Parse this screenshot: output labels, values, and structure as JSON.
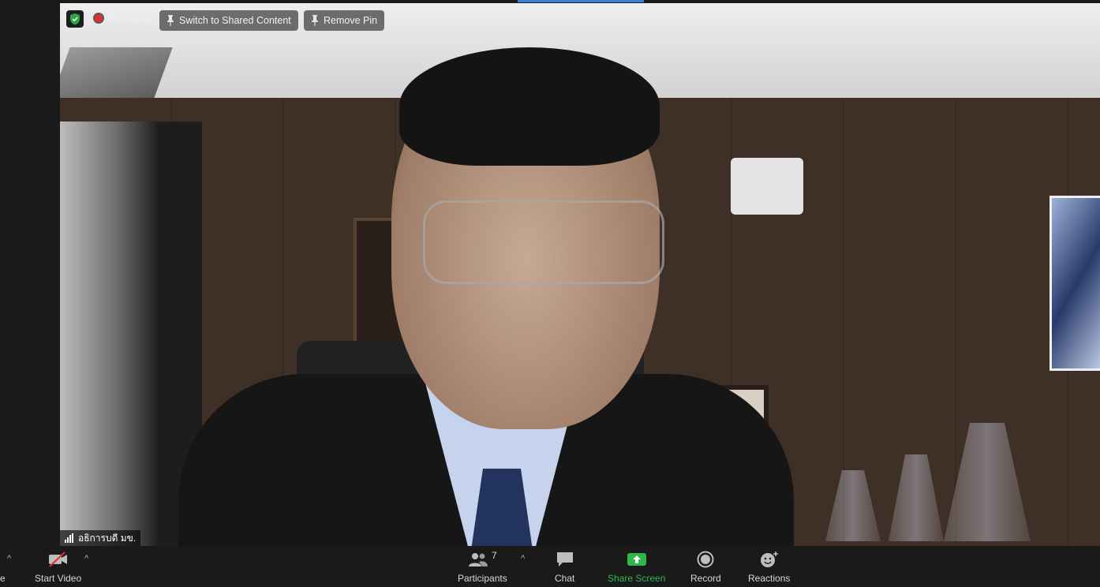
{
  "top_bar": {
    "recording_label": "Recording",
    "switch_label": "Switch to Shared Content",
    "remove_pin_label": "Remove Pin"
  },
  "participant": {
    "name": "อธิการบดี มข."
  },
  "toolbar": {
    "left_cut_label": "e",
    "start_video_label": "Start Video",
    "participants_label": "Participants",
    "participants_count": "7",
    "chat_label": "Chat",
    "share_screen_label": "Share Screen",
    "record_label": "Record",
    "reactions_label": "Reactions"
  },
  "colors": {
    "share_green": "#2fb84a",
    "record_red": "#e0302d",
    "shield_green": "#27a83d"
  }
}
